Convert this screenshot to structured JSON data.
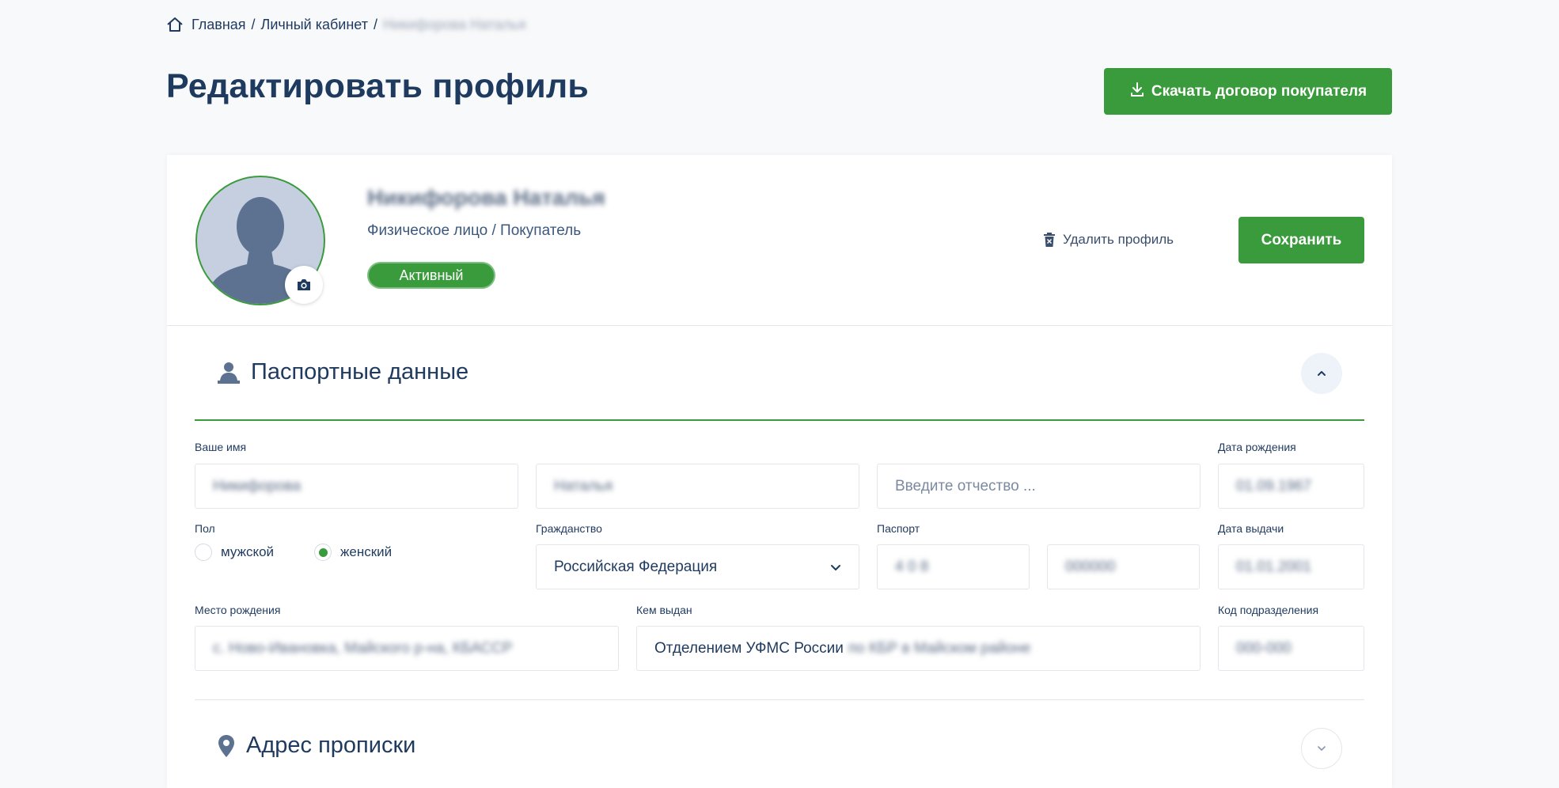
{
  "breadcrumb": {
    "home": "Главная",
    "cabinet": "Личный кабинет",
    "current": "Никифорова Наталья"
  },
  "header": {
    "title": "Редактировать профиль",
    "download_label": "Скачать договор покупателя"
  },
  "profile": {
    "name": "Никифорова Наталья",
    "role": "Физическое лицо / Покупатель",
    "status": "Активный",
    "delete_label": "Удалить профиль",
    "save_label": "Сохранить"
  },
  "passport_section": {
    "title": "Паспортные данные",
    "labels": {
      "name": "Ваше имя",
      "birth_date": "Дата рождения",
      "gender": "Пол",
      "citizenship": "Гражданство",
      "passport": "Паспорт",
      "issue_date": "Дата выдачи",
      "birth_place": "Место рождения",
      "issued_by": "Кем выдан",
      "division_code": "Код подразделения"
    },
    "values": {
      "last_name": "Никифорова",
      "first_name": "Наталья",
      "birth_date": "01.09.1967",
      "citizenship": "Российская Федерация",
      "passport_series": "4 0 8",
      "passport_number": "000000",
      "issue_date": "01.01.2001",
      "birth_place": "с. Ново-Ивановка, Майского р-на, КБАССР",
      "issued_by_visible": "Отделением УФМС России",
      "issued_by_hidden": "по КБР в Майском районе",
      "division_code": "000-000"
    },
    "placeholders": {
      "patronymic": "Введите отчество ..."
    },
    "gender_options": {
      "male": "мужской",
      "female": "женский"
    },
    "gender_selected": "female"
  },
  "address_section": {
    "title": "Адрес прописки"
  },
  "colors": {
    "accent": "#3a9b3c",
    "text": "#1f3a5f",
    "background": "#f8f9fa"
  },
  "icons": [
    "home-icon",
    "download-icon",
    "camera-icon",
    "trash-icon",
    "user-icon",
    "chevron-up-icon",
    "map-pin-icon",
    "chevron-down-icon"
  ]
}
